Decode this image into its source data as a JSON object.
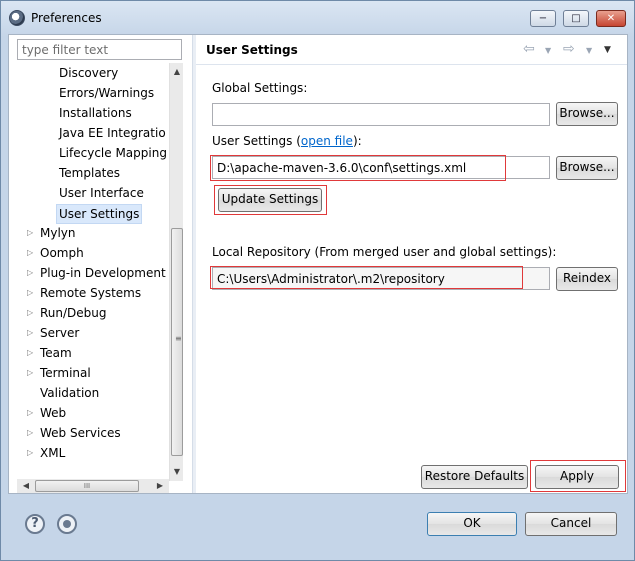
{
  "window": {
    "title": "Preferences",
    "minimize_glyph": "−",
    "maximize_glyph": "□",
    "close_glyph": "✕"
  },
  "filter": {
    "placeholder": "type filter text",
    "value": ""
  },
  "tree": {
    "items": [
      {
        "label": "Discovery",
        "expandable": false,
        "level": 2
      },
      {
        "label": "Errors/Warnings",
        "expandable": false,
        "level": 2
      },
      {
        "label": "Installations",
        "expandable": false,
        "level": 2
      },
      {
        "label": "Java EE Integratio",
        "expandable": false,
        "level": 2
      },
      {
        "label": "Lifecycle Mapping",
        "expandable": false,
        "level": 2
      },
      {
        "label": "Templates",
        "expandable": false,
        "level": 2
      },
      {
        "label": "User Interface",
        "expandable": false,
        "level": 2
      },
      {
        "label": "User Settings",
        "expandable": false,
        "level": 2,
        "selected": true
      },
      {
        "label": "Mylyn",
        "expandable": true,
        "level": 1
      },
      {
        "label": "Oomph",
        "expandable": true,
        "level": 1
      },
      {
        "label": "Plug-in Development",
        "expandable": true,
        "level": 1
      },
      {
        "label": "Remote Systems",
        "expandable": true,
        "level": 1
      },
      {
        "label": "Run/Debug",
        "expandable": true,
        "level": 1
      },
      {
        "label": "Server",
        "expandable": true,
        "level": 1
      },
      {
        "label": "Team",
        "expandable": true,
        "level": 1
      },
      {
        "label": "Terminal",
        "expandable": true,
        "level": 1
      },
      {
        "label": "Validation",
        "expandable": false,
        "level": 1
      },
      {
        "label": "Web",
        "expandable": true,
        "level": 1
      },
      {
        "label": "Web Services",
        "expandable": true,
        "level": 1
      },
      {
        "label": "XML",
        "expandable": true,
        "level": 1
      }
    ],
    "hscroll_grip": "III",
    "vscroll_grip": "≡"
  },
  "page": {
    "title": "User Settings",
    "global_settings_label": "Global Settings:",
    "global_settings_value": "",
    "browse_label": "Browse...",
    "user_settings_label": "User Settings (",
    "open_file_link": "open file",
    "user_settings_label_end": "):",
    "user_settings_value": "D:\\apache-maven-3.6.0\\conf\\settings.xml",
    "update_settings_label": "Update Settings",
    "local_repo_label": "Local Repository (From merged user and global settings):",
    "local_repo_value": "C:\\Users\\Administrator\\.m2\\repository",
    "reindex_label": "Reindex",
    "restore_defaults_label": "Restore Defaults",
    "apply_label": "Apply"
  },
  "dialog": {
    "ok_label": "OK",
    "cancel_label": "Cancel",
    "help_glyph": "?"
  },
  "icons": {
    "back": "⇦",
    "forward": "⇨",
    "dropdown": "▼",
    "menu": "▼",
    "expand": "▷",
    "scroll_up": "▲",
    "scroll_down": "▼",
    "scroll_left": "◀",
    "scroll_right": "▶"
  },
  "colors": {
    "highlight_box": "#e0393a",
    "link": "#0066cc",
    "selection": "#d9e8fb"
  }
}
